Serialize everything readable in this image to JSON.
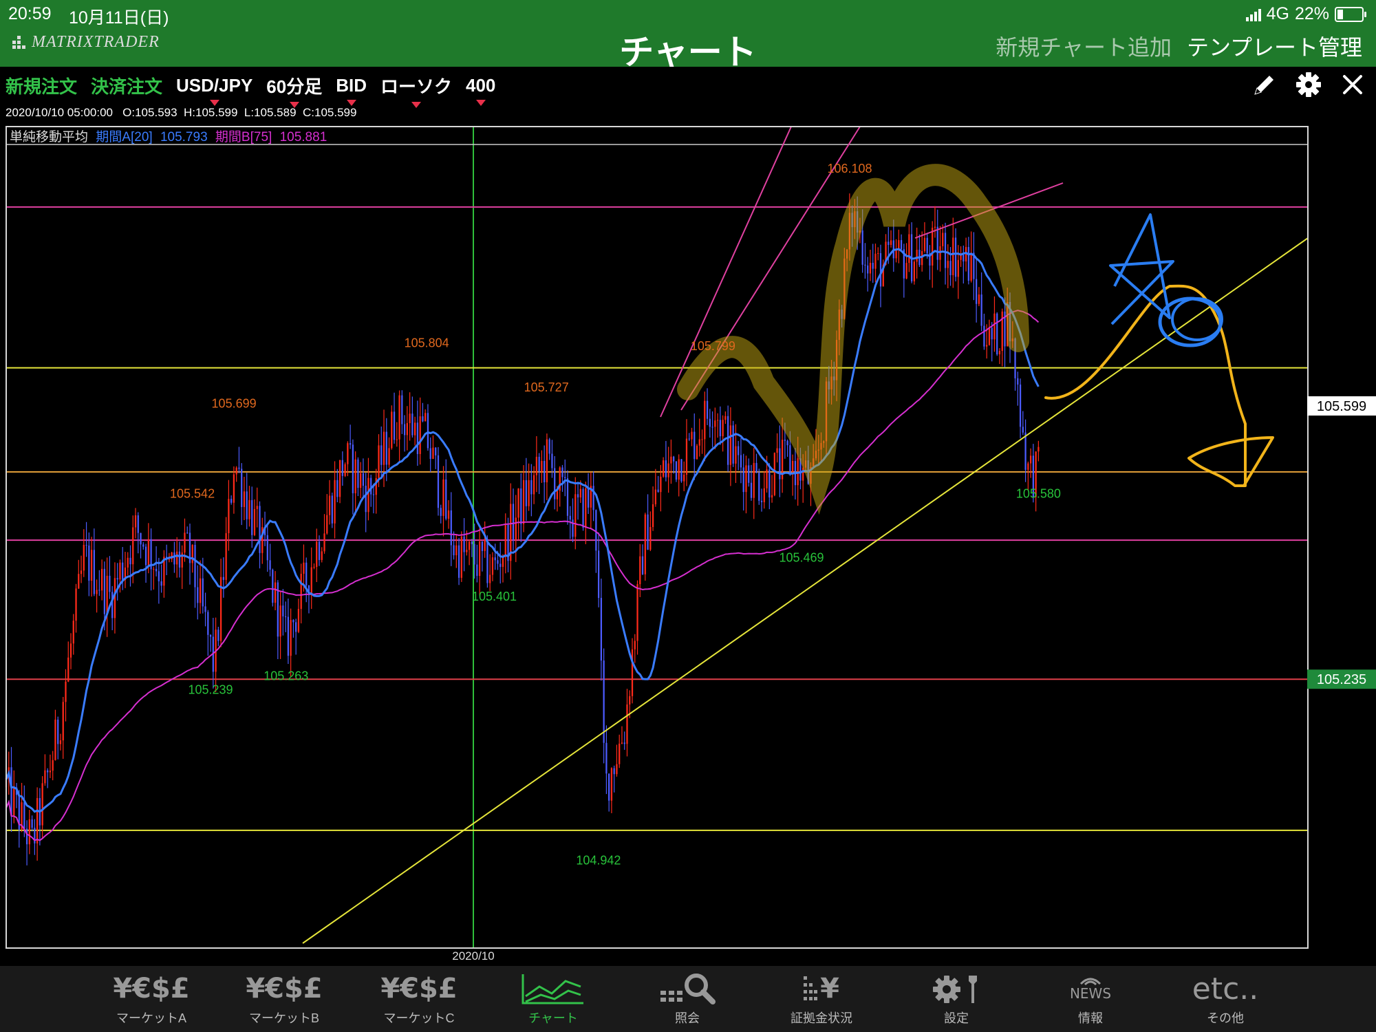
{
  "status": {
    "time": "20:59",
    "date": "10月11日(日)",
    "network": "4G",
    "battery": "22%"
  },
  "header": {
    "logo": "MATRIXTRADER",
    "title": "チャート",
    "add_chart": "新規チャート追加",
    "template_manage": "テンプレート管理"
  },
  "toolbar": {
    "new_order": "新規注文",
    "settle_order": "決済注文",
    "symbol": "USD/JPY",
    "timeframe": "60分足",
    "price_type": "BID",
    "chart_style": "ローソク",
    "count": "400",
    "icons": [
      "pencil-icon",
      "gear-icon",
      "close-icon"
    ]
  },
  "ohlc": {
    "datetime": "2020/10/10 05:00:00",
    "open": "O:105.593",
    "high": "H:105.599",
    "low": "L:105.589",
    "close": "C:105.599"
  },
  "chart_data": {
    "type": "candlestick",
    "indicator": {
      "name": "単純移動平均",
      "a_label": "期間A[20]",
      "a_value": "105.793",
      "b_label": "期間B[75]",
      "b_value": "105.881"
    },
    "ylim": [
      104.77,
      106.2
    ],
    "x_label": "2020/10",
    "current_price": "105.599",
    "marker_price": "105.235",
    "colors": {
      "up": "#ff2a1a",
      "down": "#4c5cff",
      "ma20": "#3a7cff",
      "ma75": "#d62fd0",
      "yellow": "#e5e53a",
      "magenta": "#e040a0",
      "orange_label": "#e0681e",
      "green_label": "#28c23a"
    },
    "high_labels": [
      {
        "x": 0.175,
        "value": "105.699"
      },
      {
        "x": 0.143,
        "value": "105.542"
      },
      {
        "x": 0.323,
        "value": "105.804"
      },
      {
        "x": 0.415,
        "value": "105.727"
      },
      {
        "x": 0.543,
        "value": "105.799"
      },
      {
        "x": 0.648,
        "value": "106.108"
      }
    ],
    "low_labels": [
      {
        "x": 0.157,
        "value": "105.239"
      },
      {
        "x": 0.215,
        "value": "105.263"
      },
      {
        "x": 0.375,
        "value": "105.401"
      },
      {
        "x": 0.455,
        "value": "104.942"
      },
      {
        "x": 0.611,
        "value": "105.469"
      },
      {
        "x": 0.793,
        "value": "105.580"
      }
    ],
    "horizontal_lines": [
      {
        "price": 106.06,
        "color": "magenta"
      },
      {
        "price": 105.78,
        "color": "yellow"
      },
      {
        "price": 105.599,
        "color": "orange"
      },
      {
        "price": 105.48,
        "color": "magenta"
      },
      {
        "price": 105.238,
        "color": "red"
      },
      {
        "price": 104.975,
        "color": "yellow"
      }
    ],
    "anchors": [
      [
        0.0,
        105.05
      ],
      [
        0.02,
        104.95
      ],
      [
        0.04,
        105.15
      ],
      [
        0.06,
        105.45
      ],
      [
        0.08,
        105.38
      ],
      [
        0.1,
        105.5
      ],
      [
        0.12,
        105.42
      ],
      [
        0.14,
        105.46
      ],
      [
        0.16,
        105.26
      ],
      [
        0.175,
        105.62
      ],
      [
        0.195,
        105.48
      ],
      [
        0.215,
        105.3
      ],
      [
        0.24,
        105.48
      ],
      [
        0.26,
        105.62
      ],
      [
        0.28,
        105.56
      ],
      [
        0.3,
        105.7
      ],
      [
        0.323,
        105.66
      ],
      [
        0.345,
        105.46
      ],
      [
        0.375,
        105.43
      ],
      [
        0.395,
        105.54
      ],
      [
        0.415,
        105.62
      ],
      [
        0.435,
        105.52
      ],
      [
        0.452,
        105.56
      ],
      [
        0.46,
        105.05
      ],
      [
        0.475,
        105.15
      ],
      [
        0.49,
        105.48
      ],
      [
        0.505,
        105.6
      ],
      [
        0.525,
        105.64
      ],
      [
        0.543,
        105.72
      ],
      [
        0.56,
        105.62
      ],
      [
        0.58,
        105.58
      ],
      [
        0.6,
        105.62
      ],
      [
        0.62,
        105.58
      ],
      [
        0.635,
        105.78
      ],
      [
        0.65,
        106.05
      ],
      [
        0.665,
        105.95
      ],
      [
        0.685,
        105.97
      ],
      [
        0.705,
        105.98
      ],
      [
        0.72,
        105.99
      ],
      [
        0.74,
        105.96
      ],
      [
        0.755,
        105.82
      ],
      [
        0.77,
        105.87
      ],
      [
        0.785,
        105.6
      ],
      [
        0.795,
        105.6
      ]
    ]
  },
  "tabs": [
    {
      "label": "マーケットA",
      "icon": "¥€$£"
    },
    {
      "label": "マーケットB",
      "icon": "¥€$£"
    },
    {
      "label": "マーケットC",
      "icon": "¥€$£"
    },
    {
      "label": "チャート",
      "icon": "chart-line-icon"
    },
    {
      "label": "照会",
      "icon": "search-icon"
    },
    {
      "label": "証拠金状況",
      "icon": "¥"
    },
    {
      "label": "設定",
      "icon": "settings-tools-icon"
    },
    {
      "label": "情報",
      "icon": "NEWS"
    },
    {
      "label": "その他",
      "icon": "etc.."
    }
  ]
}
